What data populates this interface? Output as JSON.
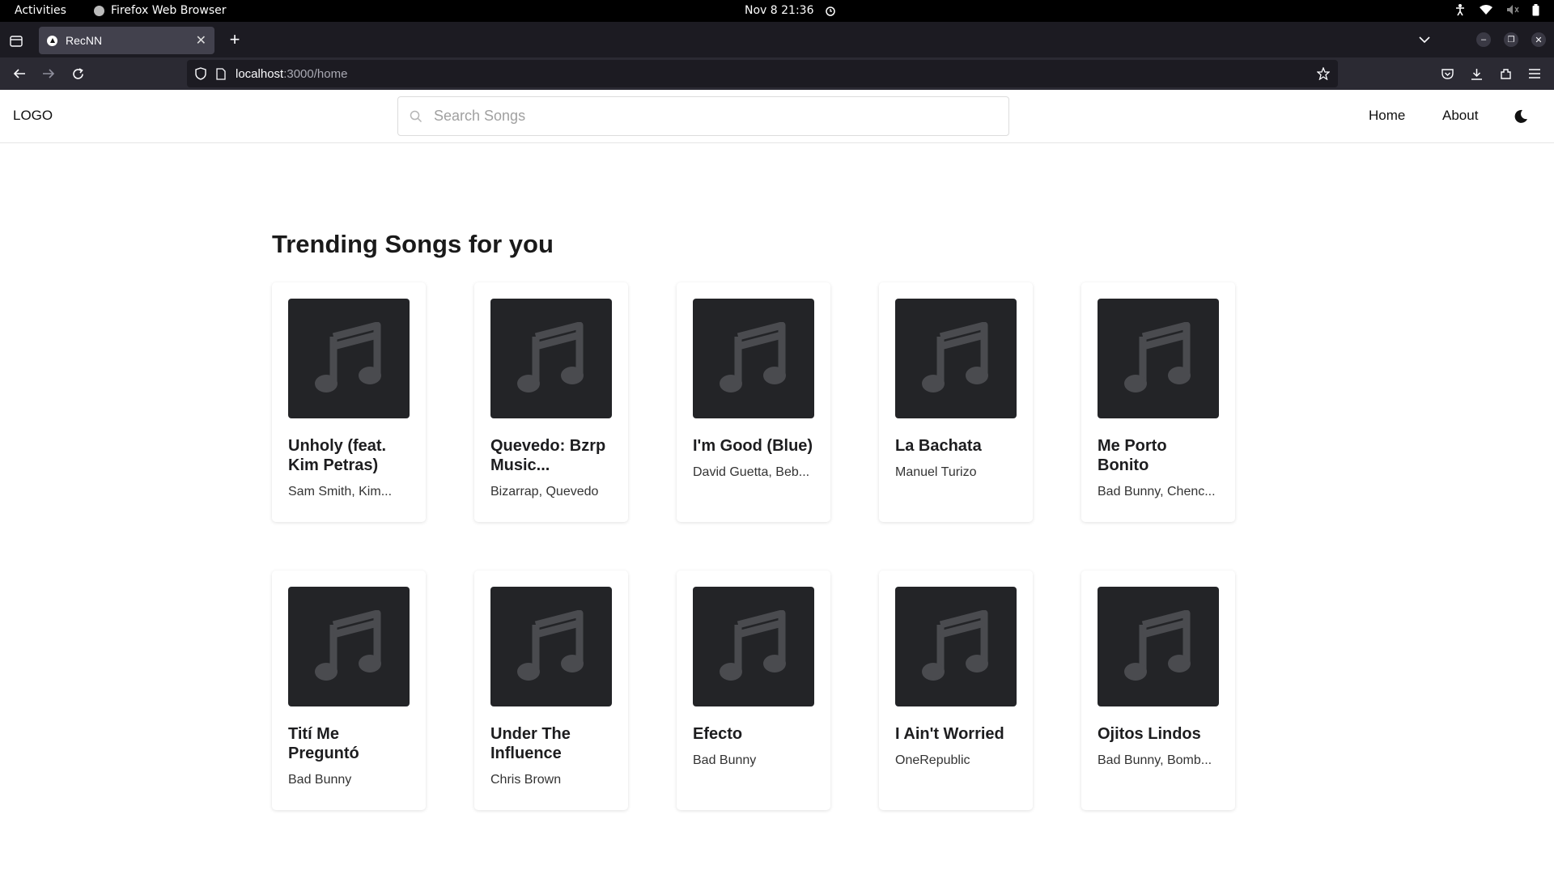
{
  "system_bar": {
    "activities": "Activities",
    "app_name": "Firefox Web Browser",
    "datetime": "Nov 8  21:36"
  },
  "browser": {
    "tab_title": "RecNN",
    "url_host": "localhost",
    "url_path": ":3000/home"
  },
  "header": {
    "logo": "LOGO",
    "search_placeholder": "Search Songs",
    "nav": [
      "Home",
      "About"
    ]
  },
  "main": {
    "section_title": "Trending Songs for you",
    "songs": [
      {
        "title": "Unholy (feat. Kim Petras)",
        "artist": "Sam Smith, Kim..."
      },
      {
        "title": "Quevedo: Bzrp Music...",
        "artist": "Bizarrap, Quevedo"
      },
      {
        "title": "I'm Good (Blue)",
        "artist": "David Guetta, Beb..."
      },
      {
        "title": "La Bachata",
        "artist": "Manuel Turizo"
      },
      {
        "title": "Me Porto Bonito",
        "artist": "Bad Bunny, Chenc..."
      },
      {
        "title": "Tití Me Preguntó",
        "artist": "Bad Bunny"
      },
      {
        "title": "Under The Influence",
        "artist": "Chris Brown"
      },
      {
        "title": "Efecto",
        "artist": "Bad Bunny"
      },
      {
        "title": "I Ain't Worried",
        "artist": "OneRepublic"
      },
      {
        "title": "Ojitos Lindos",
        "artist": "Bad Bunny, Bomb..."
      }
    ]
  }
}
